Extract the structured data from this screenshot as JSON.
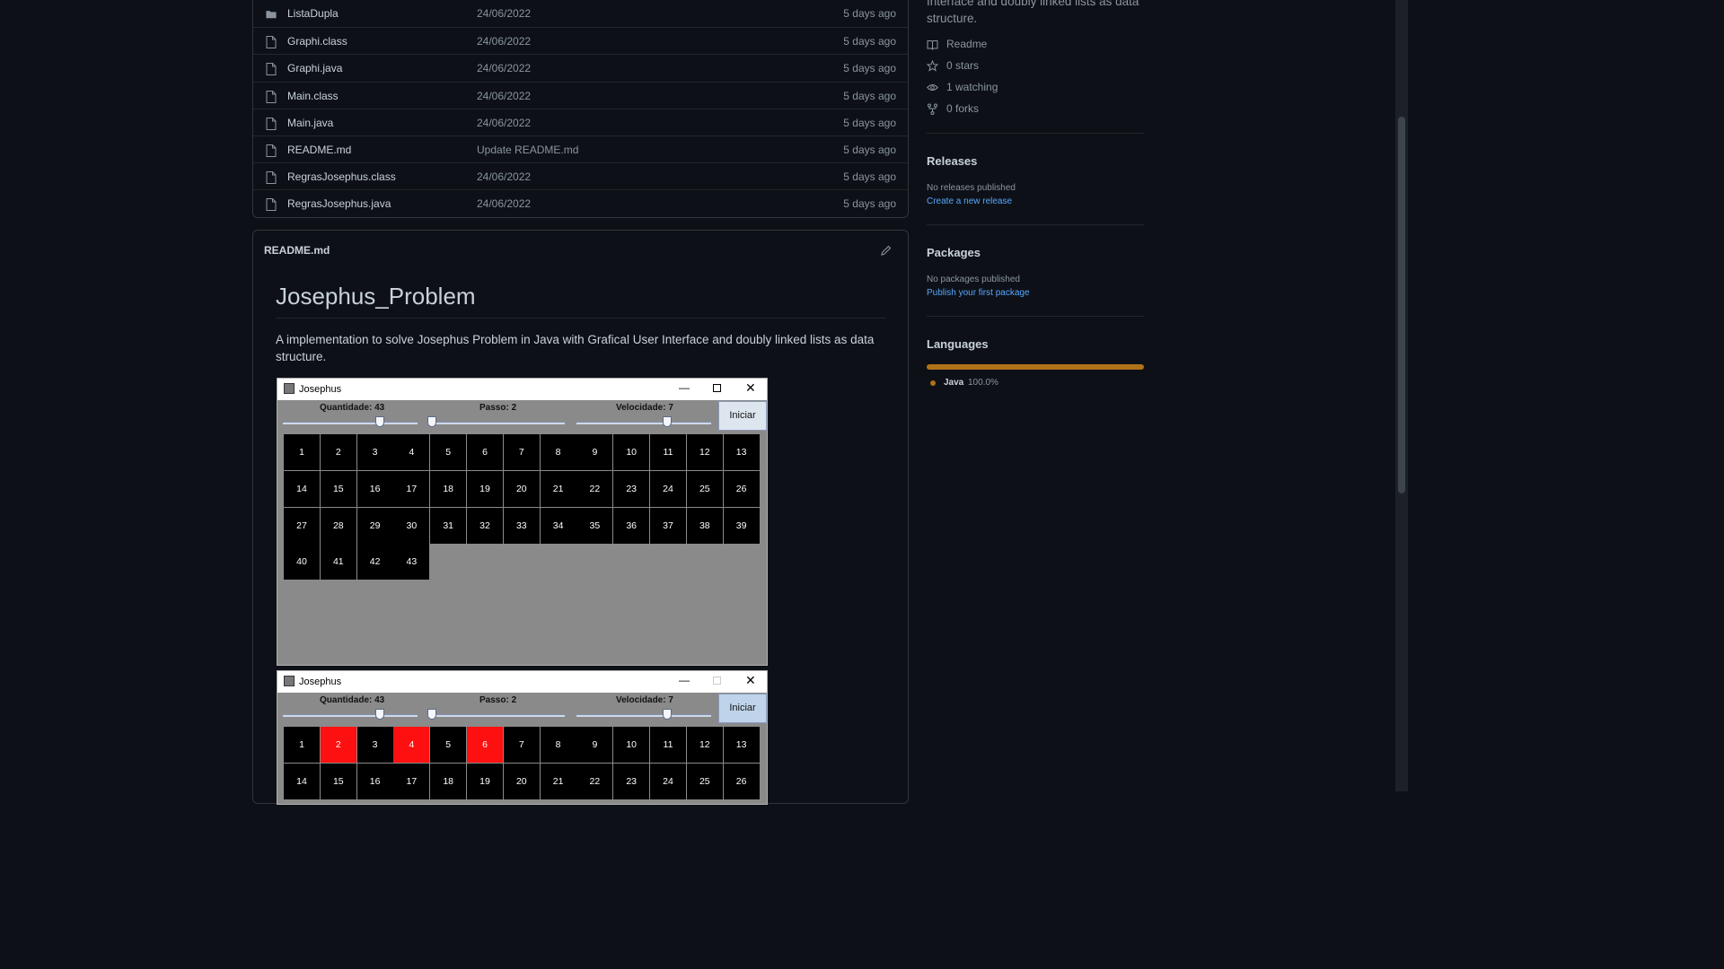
{
  "files": [
    {
      "name": "ListaDupla",
      "type": "folder",
      "commit": "24/06/2022",
      "age": "5 days ago"
    },
    {
      "name": "Graphi.class",
      "type": "file",
      "commit": "24/06/2022",
      "age": "5 days ago"
    },
    {
      "name": "Graphi.java",
      "type": "file",
      "commit": "24/06/2022",
      "age": "5 days ago"
    },
    {
      "name": "Main.class",
      "type": "file",
      "commit": "24/06/2022",
      "age": "5 days ago"
    },
    {
      "name": "Main.java",
      "type": "file",
      "commit": "24/06/2022",
      "age": "5 days ago"
    },
    {
      "name": "README.md",
      "type": "file",
      "commit": "Update README.md",
      "age": "5 days ago"
    },
    {
      "name": "RegrasJosephus.class",
      "type": "file",
      "commit": "24/06/2022",
      "age": "5 days ago"
    },
    {
      "name": "RegrasJosephus.java",
      "type": "file",
      "commit": "24/06/2022",
      "age": "5 days ago"
    }
  ],
  "readme": {
    "filename": "README.md",
    "title": "Josephus_Problem",
    "description": "A implementation to solve Josephus Problem in Java with Grafical User Interface and doubly linked lists as data structure."
  },
  "app_windows": [
    {
      "title": "Josephus",
      "quantity_label": "Quantidade: 43",
      "step_label": "Passo: 2",
      "speed_label": "Velocidade: 7",
      "start_label": "Iniciar",
      "quantity_value": 0.72,
      "step_value": 0.0,
      "speed_value": 0.67,
      "cells": [
        "1",
        "2",
        "3",
        "4",
        "5",
        "6",
        "7",
        "8",
        "9",
        "10",
        "11",
        "12",
        "13",
        "14",
        "15",
        "16",
        "17",
        "18",
        "19",
        "20",
        "21",
        "22",
        "23",
        "24",
        "25",
        "26",
        "27",
        "28",
        "29",
        "30",
        "31",
        "32",
        "33",
        "34",
        "35",
        "36",
        "37",
        "38",
        "39",
        "40",
        "41",
        "42",
        "43"
      ],
      "eliminated": []
    },
    {
      "title": "Josephus",
      "quantity_label": "Quantidade: 43",
      "step_label": "Passo: 2",
      "speed_label": "Velocidade: 7",
      "start_label": "Iniciar",
      "quantity_value": 0.72,
      "step_value": 0.0,
      "speed_value": 0.67,
      "cells": [
        "1",
        "2",
        "3",
        "4",
        "5",
        "6",
        "7",
        "8",
        "9",
        "10",
        "11",
        "12",
        "13",
        "14",
        "15",
        "16",
        "17",
        "18",
        "19",
        "20",
        "21",
        "22",
        "23",
        "24",
        "25",
        "26"
      ],
      "eliminated": [
        "2",
        "4",
        "6"
      ]
    }
  ],
  "sidebar": {
    "about_tail": "Interface and doubly linked lists as data structure.",
    "links": [
      {
        "label": "Readme",
        "icon": "book-icon"
      },
      {
        "label": "0 stars",
        "icon": "star-icon"
      },
      {
        "label": "1 watching",
        "icon": "eye-icon"
      },
      {
        "label": "0 forks",
        "icon": "fork-icon"
      }
    ],
    "releases": {
      "heading": "Releases",
      "empty": "No releases published",
      "link": "Create a new release"
    },
    "packages": {
      "heading": "Packages",
      "empty": "No packages published",
      "link": "Publish your first package"
    },
    "languages": {
      "heading": "Languages",
      "items": [
        {
          "name": "Java",
          "percent": "100.0%",
          "share": 1.0,
          "color": "#b07219"
        }
      ]
    }
  },
  "colors": {
    "background": "#0d1117",
    "link": "#58a6ff",
    "eliminated_cell": "#ff1010"
  }
}
